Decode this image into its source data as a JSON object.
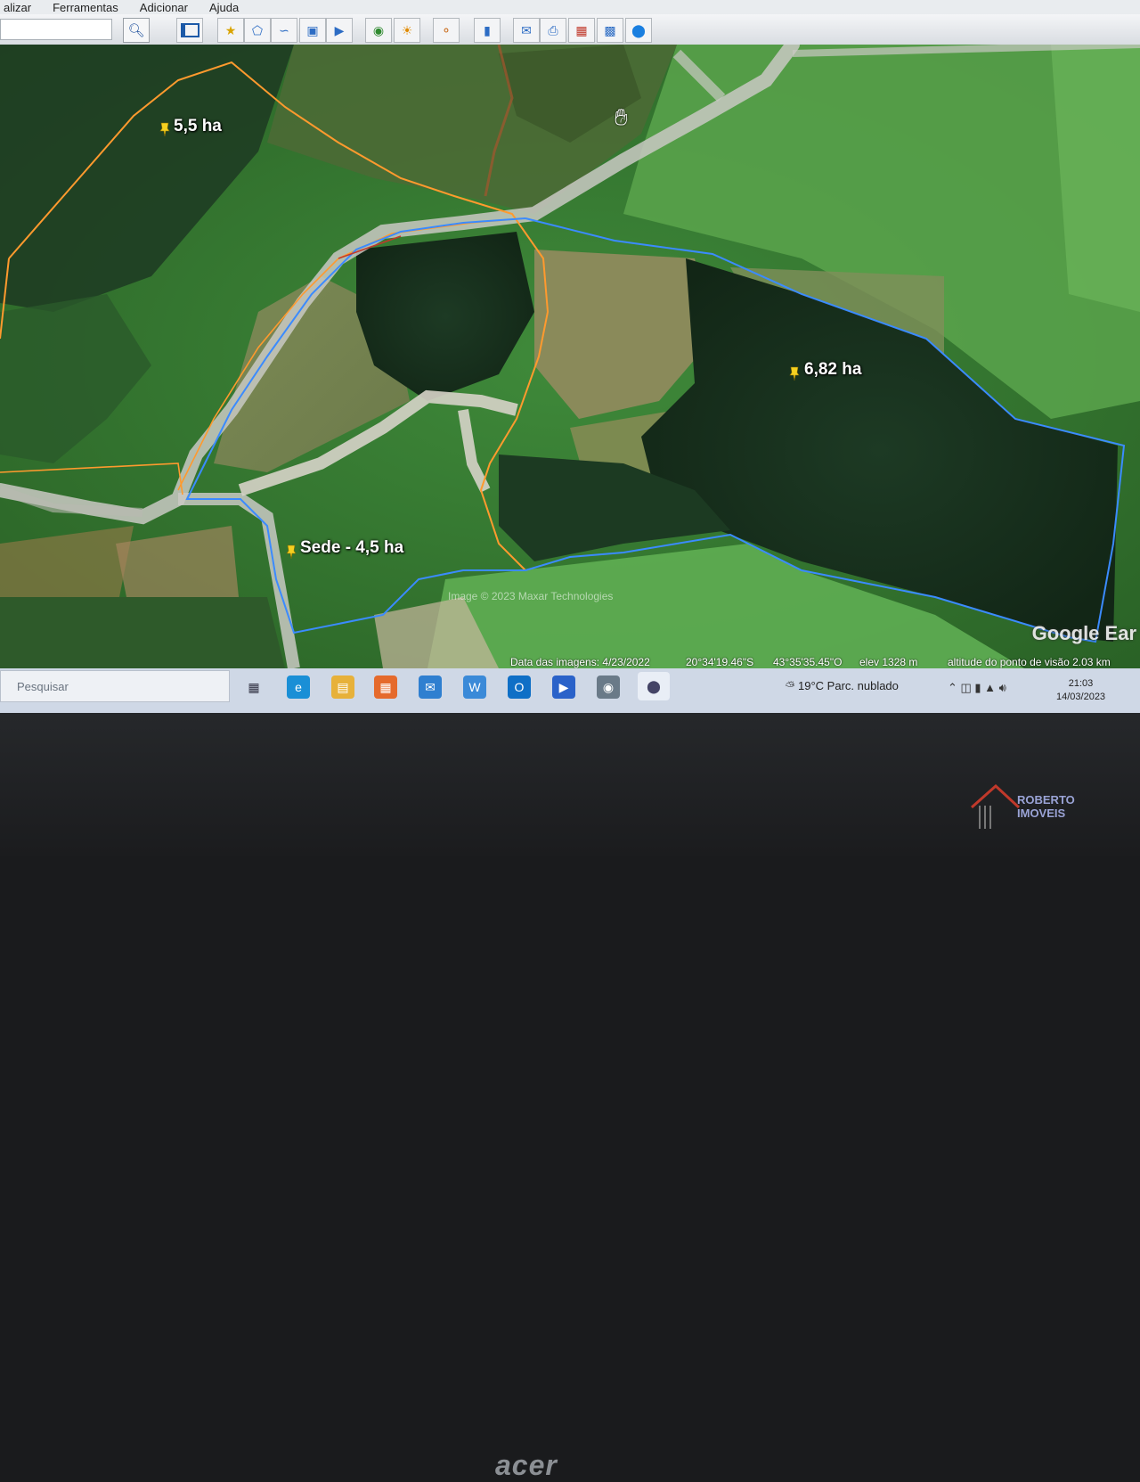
{
  "menu": {
    "items": [
      "alizar",
      "Ferramentas",
      "Adicionar",
      "Ajuda"
    ]
  },
  "toolbar": {
    "search_icon": "magnifier-icon",
    "buttons": [
      "sidebar-icon",
      "placemark-icon",
      "polygon-icon",
      "path-icon",
      "overlay-icon",
      "tour-icon",
      "historical-imagery-icon",
      "sunlight-icon",
      "planets-icon",
      "ruler-icon",
      "email-icon",
      "print-icon",
      "save-image-icon",
      "maps-icon",
      "earth-icon"
    ]
  },
  "map": {
    "placemarks": [
      {
        "label": "5,5 ha"
      },
      {
        "label": "6,82 ha"
      },
      {
        "label": "Sede - 4,5 ha"
      }
    ],
    "copyright": "Image © 2023 Maxar Technologies",
    "logo": "Google Ear",
    "colors": {
      "orange_boundary": "#ff9a2e",
      "blue_boundary": "#3b8bff",
      "pin": "#f5d020"
    }
  },
  "status": {
    "imagery_date": "Data das imagens: 4/23/2022",
    "lat": "20°34'19.46\"S",
    "lon": "43°35'35.45\"O",
    "elev": "elev 1328 m",
    "eye_alt": "altitude do ponto de visão 2.03 km"
  },
  "taskbar": {
    "search_placeholder": "Pesquisar",
    "weather": "19°C  Parc. nublado",
    "time": "21:03",
    "date": "14/03/2023"
  },
  "bezel": {
    "brand": "acer"
  },
  "watermark": {
    "line1": "ROBERTO",
    "line2": "IMOVEIS"
  }
}
